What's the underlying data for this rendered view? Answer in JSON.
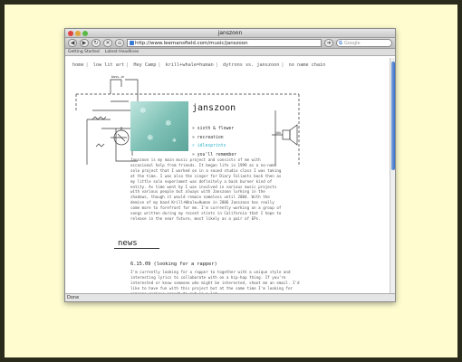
{
  "window": {
    "title": "janszoon",
    "url": "http://www.leemansfield.com/music/janszoon",
    "search_placeholder": "Google",
    "bookmarks": [
      "Getting Started",
      "Latest Headlines"
    ],
    "status": "Done"
  },
  "site": {
    "nav": [
      "home",
      "low lit art",
      "Hey Camp",
      "krill+whale=human",
      "dytrons vs. janszoon",
      "no name chain"
    ],
    "title": "janszoon",
    "submenu": [
      {
        "label": "» sixth & flower",
        "active": false
      },
      {
        "label": "» recreation",
        "active": false
      },
      {
        "label": "» idlesprints",
        "active": true
      },
      {
        "label": "» you'll remember",
        "active": false
      }
    ],
    "schematic_labels": [
      "bass-in",
      "10k"
    ],
    "blurb": "Janszoon is my main music project and consists of me with occasional help from friends. It began life in 1999 as a no-name solo project that I worked on in a sound studio class I was taking at the time. I was also the singer for Diary Foliants back then as my little solo experiment was definitely a back burner kind of entity. As time went by I was involved in various music projects with various people but always with Janszoon lurking in the shadows, though it would remain nameless until 2004. With the demise of my band Krill+Whale=Human in 2006 Janszoon has really come more to forefront for me. I'm currently working on a group of songs written during my recent stints in California that I hope to release in the near future, most likely as a pair of EPs.",
    "news_heading": "news",
    "post_title": "6.15.09 (looking for a rapper)",
    "post_body": "I'm currently looking for a rapper to together with a unique style and interesting lyrics to collaborate with on a hip-hop thing. If you're interested or know someone who might be interested, shoot me an email. I'd like to have fun with this project but at the same time I'm looking for someone serious enough to put in a lot"
  }
}
